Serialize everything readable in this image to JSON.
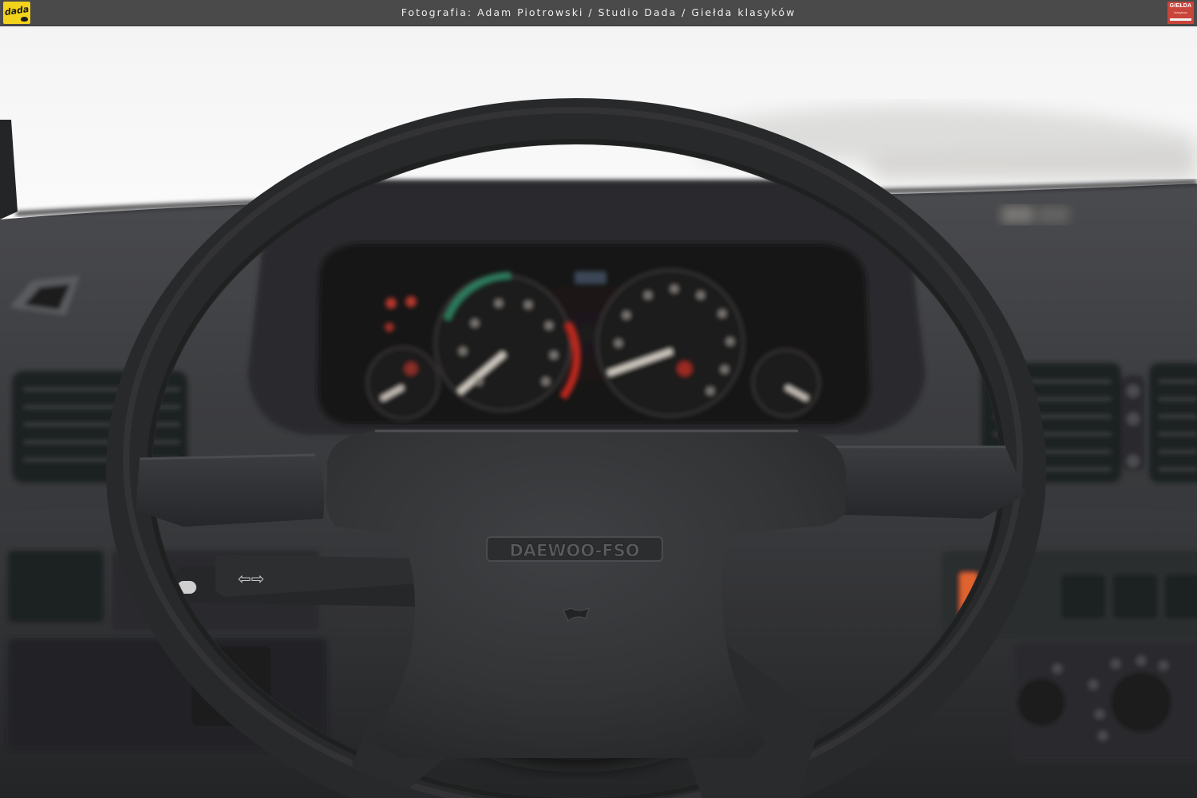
{
  "header": {
    "caption": "Fotografia: Adam Piotrowski / Studio Dada / Giełda klasyków",
    "left_logo": {
      "icon": "dada-logo-icon",
      "text": "dada",
      "color": "#f2d21b"
    },
    "right_logo": {
      "icon": "gielda-klasykow-logo-icon",
      "text": "GIEŁDA klasyków",
      "color": "#c9443a"
    }
  },
  "photo": {
    "subject": "steering-wheel-dashboard",
    "horn_pad_emblem": "DAEWOO-FSO",
    "colors": {
      "windshield": "#f6f6f6",
      "dashboard": "#3a3b3d",
      "wheel": "#2b2c2e"
    }
  }
}
